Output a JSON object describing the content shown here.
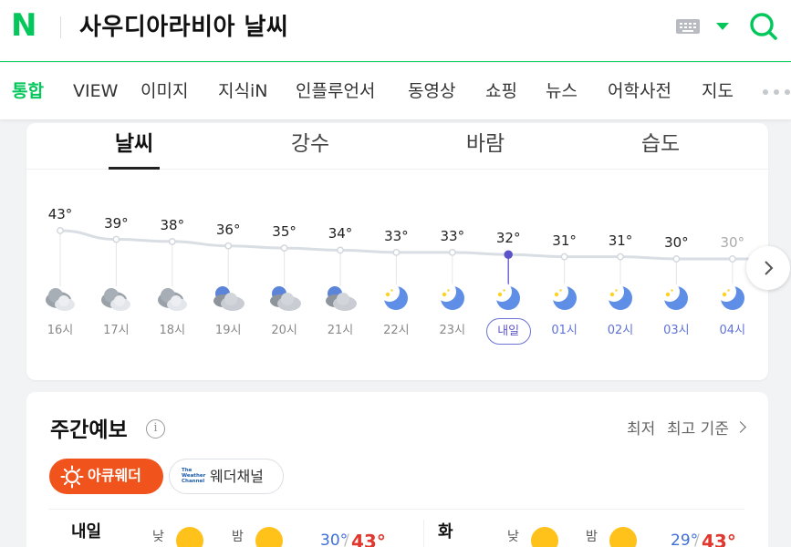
{
  "header": {
    "logo_letter": "N",
    "query": "사우디아라비아 날씨"
  },
  "icons": {
    "keyboard": "keyboard-icon",
    "dropdown": "chevron-down-icon",
    "search": "search-icon",
    "more": "more-dots-icon",
    "next": "chevron-right-icon",
    "info": "info-icon"
  },
  "colors": {
    "brand": "#03c75a",
    "night_hour": "#5f72d8",
    "max_temp": "#e0382c",
    "min_temp": "#3e6fd6",
    "accuweather": "#f0531c",
    "sun": "#ffc21a"
  },
  "search_tabs": [
    "통합",
    "VIEW",
    "이미지",
    "지식iN",
    "인플루언서",
    "동영상",
    "쇼핑",
    "뉴스",
    "어학사전",
    "지도"
  ],
  "weather_tabs": [
    "날씨",
    "강수",
    "바람",
    "습도"
  ],
  "hourly": [
    {
      "hour": "16시",
      "temp": "43°",
      "icon": "cloudy-icon",
      "night": false
    },
    {
      "hour": "17시",
      "temp": "39°",
      "icon": "cloudy-icon",
      "night": false
    },
    {
      "hour": "18시",
      "temp": "38°",
      "icon": "cloudy-icon",
      "night": false
    },
    {
      "hour": "19시",
      "temp": "36°",
      "icon": "cloudy-night-icon",
      "night": false
    },
    {
      "hour": "20시",
      "temp": "35°",
      "icon": "cloudy-night-icon",
      "night": false
    },
    {
      "hour": "21시",
      "temp": "34°",
      "icon": "cloudy-night-icon",
      "night": false
    },
    {
      "hour": "22시",
      "temp": "33°",
      "icon": "clear-night-icon",
      "night": false
    },
    {
      "hour": "23시",
      "temp": "33°",
      "icon": "clear-night-icon",
      "night": false
    },
    {
      "hour": "내일",
      "temp": "32°",
      "icon": "clear-night-icon",
      "night": true,
      "highlight": true
    },
    {
      "hour": "01시",
      "temp": "31°",
      "icon": "clear-night-icon",
      "night": true
    },
    {
      "hour": "02시",
      "temp": "31°",
      "icon": "clear-night-icon",
      "night": true
    },
    {
      "hour": "03시",
      "temp": "30°",
      "icon": "clear-night-icon",
      "night": true
    },
    {
      "hour": "04시",
      "temp": "30°",
      "icon": "clear-night-icon",
      "night": true,
      "faded": true
    }
  ],
  "weekly": {
    "title": "주간예보",
    "sort_min": "최저",
    "sort_max_label": "최고 기준",
    "sources": {
      "accuweather": "아큐웨더",
      "twc_logo": "The Weather Channel",
      "twc": "웨더채널"
    },
    "labels": {
      "day": "낮",
      "night": "밤"
    },
    "days": [
      {
        "name": "내일",
        "min": "30°",
        "max": "43°",
        "day_icon": "sunny-icon",
        "night_icon": "sunny-icon"
      },
      {
        "name": "화",
        "min": "29°",
        "max": "43°",
        "day_icon": "sunny-icon",
        "night_icon": "sunny-icon"
      }
    ]
  }
}
